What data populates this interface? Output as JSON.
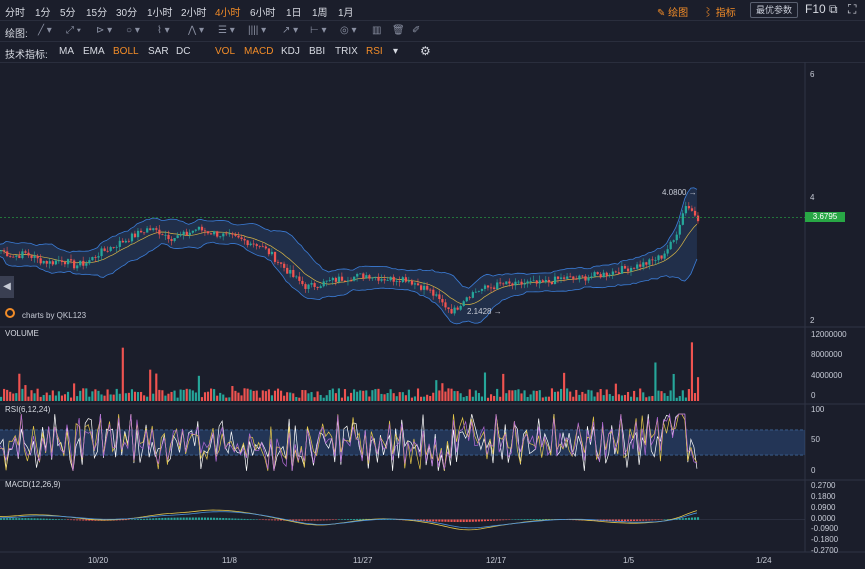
{
  "timeframes": [
    "分时",
    "1分",
    "5分",
    "15分",
    "30分",
    "1小时",
    "2小时",
    "4小时",
    "6小时",
    "1日",
    "1周",
    "1月"
  ],
  "active_timeframe": "4小时",
  "toolbar_right": {
    "draw_label": "绘图",
    "indicator_label": "指标",
    "optimize_label": "最优参数",
    "f10_label": "F10"
  },
  "draw_label": "绘图:",
  "indicators_label": "技术指标:",
  "main_indicators": [
    {
      "label": "MA",
      "on": false
    },
    {
      "label": "EMA",
      "on": false
    },
    {
      "label": "BOLL",
      "on": true
    },
    {
      "label": "SAR",
      "on": false
    },
    {
      "label": "DC",
      "on": false
    }
  ],
  "sub_indicators": [
    {
      "label": "VOL",
      "on": true
    },
    {
      "label": "MACD",
      "on": true
    },
    {
      "label": "KDJ",
      "on": false
    },
    {
      "label": "BBI",
      "on": false
    },
    {
      "label": "TRIX",
      "on": false
    },
    {
      "label": "RSI",
      "on": true
    }
  ],
  "colors": {
    "up": "#26a69a",
    "down": "#ef5350",
    "accent": "#f28c28",
    "boll": "#3b7dd8",
    "price_line": "#28a745"
  },
  "watermark": "charts by QKL123",
  "panels": {
    "volume": "VOLUME",
    "rsi": "RSI(6,12,24)",
    "macd": "MACD(12,26,9)"
  },
  "chart_data": {
    "type": "candlestick",
    "price_axis": [
      "6",
      "4",
      "2"
    ],
    "last_price": "3.6795",
    "high_marker": "4.0800",
    "low_marker": "2.1428",
    "volume_axis": [
      "12000000",
      "8000000",
      "4000000",
      "0"
    ],
    "rsi_axis": [
      "100",
      "50",
      "0"
    ],
    "macd_axis": [
      "0.2700",
      "0.1800",
      "0.0900",
      "0.0000",
      "-0.0900",
      "-0.1800",
      "-0.2700"
    ],
    "x_labels": [
      "10/20",
      "11/8",
      "11/27",
      "12/17",
      "1/5",
      "1/24"
    ],
    "close_series": [
      3.15,
      3.05,
      3.1,
      3.0,
      2.95,
      3.0,
      2.9,
      2.95,
      3.1,
      3.2,
      3.3,
      3.4,
      3.5,
      3.45,
      3.35,
      3.4,
      3.5,
      3.45,
      3.4,
      3.35,
      3.3,
      3.25,
      3.1,
      2.9,
      2.7,
      2.55,
      2.6,
      2.65,
      2.7,
      2.72,
      2.75,
      2.7,
      2.68,
      2.7,
      2.6,
      2.5,
      2.3,
      2.15,
      2.4,
      2.5,
      2.55,
      2.6,
      2.58,
      2.62,
      2.6,
      2.65,
      2.7,
      2.68,
      2.72,
      2.75,
      2.8,
      2.85,
      2.9,
      2.95,
      3.05,
      3.3,
      3.9,
      3.68
    ]
  }
}
